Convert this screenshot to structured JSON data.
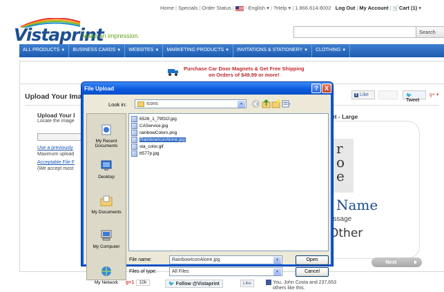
{
  "header": {
    "top_links": [
      "Home",
      "Specials",
      "Order Status"
    ],
    "language": "- English",
    "help": "Help",
    "phone": "1.866.614.8002",
    "logout": "Log Out",
    "my_account": "My Account",
    "cart": "Cart (1)",
    "logo_text": "Vistaprint",
    "tagline": "Make an impression.",
    "search_button": "Search"
  },
  "nav": [
    "ALL PRODUCTS",
    "BUSINESS CARDS",
    "WEBSITES",
    "MARKETING PRODUCTS",
    "INVITATIONS & STATIONERY",
    "CLOTHING"
  ],
  "promo": {
    "line1": "Purchase Car Door Magnets & Get Free Shipping",
    "line2": "on Orders of $49.99 or more!"
  },
  "page": {
    "heading": "Upload Your Ima",
    "sub_heading": "Upload Your I",
    "locate_text": "Locate the image",
    "use_previous_link": "Use a previously",
    "max_upload": "Maximum upload",
    "acceptable_link": "Acceptable File F",
    "accept_most": "(We accept most"
  },
  "social": {
    "like": "Like",
    "tweet": "Tweet"
  },
  "preview": {
    "size_label": "et - Large",
    "strip_letters": [
      "r",
      "o",
      "e"
    ],
    "name": "Name",
    "message": "essage",
    "other": "Other",
    "next_button": "Next"
  },
  "footer": {
    "gplus": "+1",
    "gplus_count": "10k",
    "follow": "Follow @Vistaprint",
    "like": "Like",
    "like_text_1": "You, John Costa and 237,653",
    "like_text_2": "others like this."
  },
  "dialog": {
    "title": "File Upload",
    "look_in_label": "Look in:",
    "look_in_value": "Icons",
    "places": [
      "My Recent Documents",
      "Desktop",
      "My Documents",
      "My Computer",
      "My Network"
    ],
    "files": [
      "6526_1_79f31f.jpg",
      "CAService.jpg",
      "rainbowColors.png",
      "RainbowIconAlone.jpg",
      "sta_color.gif",
      "tt577p.jpg"
    ],
    "selected_file": "RainbowIconAlone.jpg",
    "file_name_label": "File name:",
    "file_name_value": "RainbowIconAlone.jpg",
    "file_type_label": "Files of type:",
    "file_type_value": "All Files",
    "open_button": "Open",
    "cancel_button": "Cancel",
    "help_glyph": "?",
    "close_glyph": "X"
  }
}
